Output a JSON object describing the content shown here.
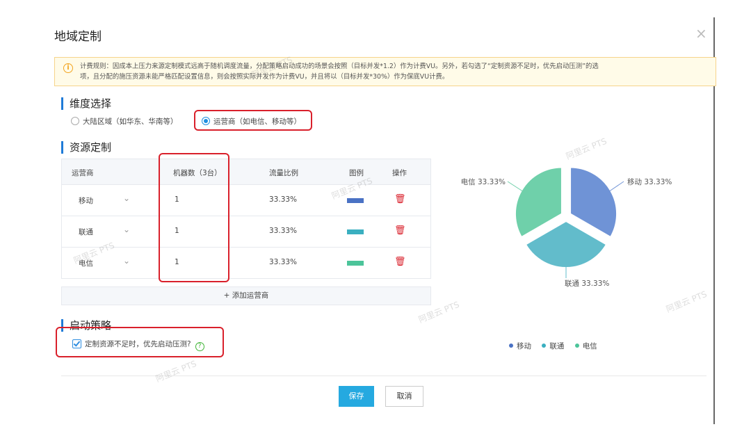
{
  "dialog": {
    "title": "地域定制",
    "close_glyph": "×"
  },
  "notice": {
    "icon": "info-icon",
    "line1": "计费规则：因成本上压力来源定制模式远高于随机调度流量，分配策略启动成功的场景会按照（目标并发*1.2）作为计费VU。另外，若勾选了“定制资源不足时，优先启动压测”的选",
    "line2": "项，且分配的施压资源未能严格匹配设置信息，则会按照实际并发作为计费VU，并且将以（目标并发*30%）作为保底VU计费。"
  },
  "dimension": {
    "heading": "维度选择",
    "options": [
      {
        "label": "大陆区域（如华东、华南等）",
        "checked": false
      },
      {
        "label": "运营商（如电信、移动等）",
        "checked": true
      }
    ]
  },
  "resource": {
    "heading": "资源定制",
    "columns": [
      "运营商",
      "机器数（3台）",
      "流量比例",
      "图例",
      "操作"
    ],
    "rows": [
      {
        "carrier": "移动",
        "machines": "1",
        "ratio": "33.33%",
        "color": "#4a72c4"
      },
      {
        "carrier": "联通",
        "machines": "1",
        "ratio": "33.33%",
        "color": "#3aafc0"
      },
      {
        "carrier": "电信",
        "machines": "1",
        "ratio": "33.33%",
        "color": "#4cc49a"
      }
    ],
    "add_label": "+ 添加运营商"
  },
  "strategy": {
    "heading": "启动策略",
    "checkbox_label": "定制资源不足时，优先启动压测?",
    "checked": true,
    "help_glyph": "?"
  },
  "buttons": {
    "save": "保存",
    "cancel": "取消"
  },
  "chart_data": {
    "type": "pie",
    "categories": [
      "移动",
      "联通",
      "电信"
    ],
    "values": [
      33.33,
      33.33,
      33.33
    ],
    "labels": [
      "移动 33.33%",
      "联通 33.33%",
      "电信 33.33%"
    ],
    "colors": [
      "#6f93d6",
      "#62bccb",
      "#6fd0aa"
    ],
    "legend_placement": "bottom"
  },
  "watermark": "阿里云 PTS"
}
